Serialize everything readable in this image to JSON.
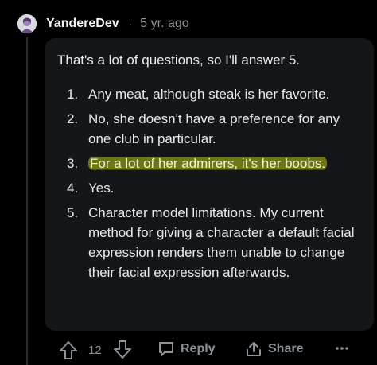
{
  "comment": {
    "author": "YandereDev",
    "separator": "·",
    "age": "5 yr. ago",
    "intro": "That's a lot of questions, so I'll answer 5.",
    "answers": [
      {
        "num": "1.",
        "text": "Any meat, although steak is her favorite."
      },
      {
        "num": "2.",
        "text": "No, she doesn't have a preference for any one club in particular."
      },
      {
        "num": "3.",
        "text": "For a lot of her admirers, it's her boobs."
      },
      {
        "num": "4.",
        "text": "Yes."
      },
      {
        "num": "5.",
        "text": "Character model limitations. My current method for giving a character a default facial expression renders them unable to change their facial expression afterwards."
      }
    ],
    "highlight_color": "#bac419"
  },
  "actions": {
    "score": "12",
    "reply_label": "Reply",
    "share_label": "Share",
    "upvote_icon": "arrow-up-icon",
    "downvote_icon": "arrow-down-icon",
    "reply_icon": "speech-bubble-icon",
    "share_icon": "share-arrow-icon",
    "more_icon": "ellipsis-icon"
  }
}
